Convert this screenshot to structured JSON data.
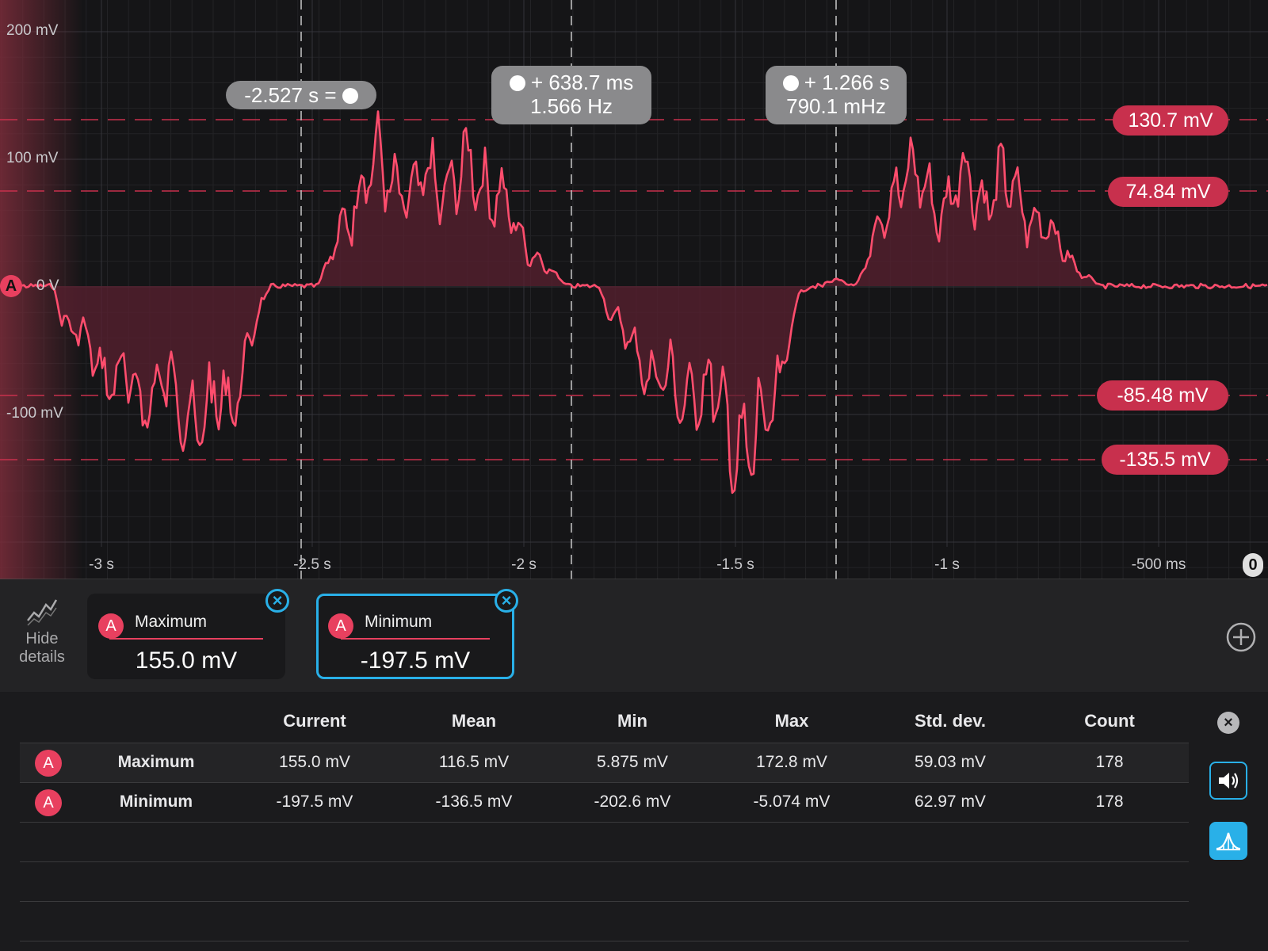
{
  "scope": {
    "y_axis": [
      "200 mV",
      "100 mV",
      "0 V",
      "-100 mV"
    ],
    "x_axis": [
      "-3 s",
      "-2.5 s",
      "-2 s",
      "-1.5 s",
      "-1 s",
      "-500 ms"
    ],
    "channel_marker": "A",
    "trigger_marker": "0",
    "level_markers": [
      "130.7 mV",
      "74.84 mV",
      "-85.48 mV",
      "-135.5 mV"
    ],
    "cursors": {
      "c1": {
        "text": "-2.527 s ="
      },
      "c2": {
        "line1": "+ 638.7 ms",
        "line2": "1.566 Hz"
      },
      "c3": {
        "line1": "+ 1.266 s",
        "line2": "790.1 mHz"
      }
    },
    "trace_color": "#ff4d6d",
    "fill_color": "#5a2030"
  },
  "details": {
    "hide_label_1": "Hide",
    "hide_label_2": "details",
    "cards": [
      {
        "channel": "A",
        "title": "Maximum",
        "value": "155.0 mV",
        "selected": false
      },
      {
        "channel": "A",
        "title": "Minimum",
        "value": "-197.5 mV",
        "selected": true
      }
    ]
  },
  "stats": {
    "columns": [
      "Current",
      "Mean",
      "Min",
      "Max",
      "Std. dev.",
      "Count"
    ],
    "rows": [
      {
        "channel": "A",
        "name": "Maximum",
        "values": [
          "155.0 mV",
          "116.5 mV",
          "5.875 mV",
          "172.8 mV",
          "59.03 mV",
          "178"
        ]
      },
      {
        "channel": "A",
        "name": "Minimum",
        "values": [
          "-197.5 mV",
          "-136.5 mV",
          "-202.6 mV",
          "-5.074 mV",
          "62.97 mV",
          "178"
        ]
      }
    ]
  },
  "colors": {
    "accent": "#29b0e8",
    "channel": "#e8405f",
    "marker": "#c8304d"
  }
}
